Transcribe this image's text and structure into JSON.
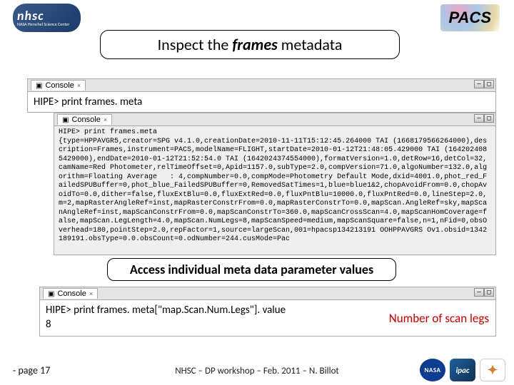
{
  "badges": {
    "nhsc_big": "nhsc",
    "nhsc_small": "NASA Herschel Science Center",
    "pacs": "PACS"
  },
  "title": {
    "pre": "Inspect the ",
    "em": "frames",
    "post": " metadata"
  },
  "console_tab": "Console",
  "cmd1": {
    "prompt": "HIPE>",
    "rest": " print frames. meta"
  },
  "output2": "HIPE> print frames.meta\n{type=HPPAVGR5,creator=SPG v4.1.0,creationDate=2010-11-11T15:12:45.264000 TAI (1668179566264000),description=Frames,instrument=PACS,modelName=FLIGHT,startDate=2010-01-12T21:48:05.429000 TAI (1642024085429000),endDate=2010-01-12T21:52:54.0 TAI (1642024374554000),formatVersion=1.0,detRow=16,detCol=32,camName=Red Photometer,relTimeOffset=0,Apid=1157.0,subType=2.0,compVersion=71.0,algoNumber=132.0,algorithm=Floating Average   : 4,compNumber=0.0,compMode=Photometry Default Mode,dxid=4001.0,phot_red_FailedSPUBuffer=0,phot_blue_FailedSPUBuffer=0,RemovedSatTimes=1,blue=blue1&2,chopAvoidFrom=0.0,chopAvoidTo=0.0,dither=false,fluxExtBlu=0.0,fluxExtRed=0.0,fluxPntBlu=10000.0,fluxPntRed=0.0,lineStep=2.0,m=2,mapRasterAngleRef=inst,mapRasterConstrFrom=0.0,mapRasterConstrTo=0.0,mapScan.AngleRef=sky,mapScanAngleRef=inst,mapScanConstrFrom=0.0,mapScanConstrTo=360.0,mapScanCrossScan=4.0,mapScanHomCoverage=false,mapScan.LegLength=4.0,mapScan.NumLegs=8,mapScanSpeed=medium,mapScanSquare=false,n=1,nFid=0,obsOverhead=180,pointStep=2.0,repFactor=1,source=largeScan,001=hpacsp134213191 OOHPPAVGRS Ov1.obsid=1342189191.obsType=0.0.obsCount=0.odNumber=244.cusMode=Pac",
  "subtitle": "Access individual meta data parameter values",
  "cmd3": {
    "prompt": "HIPE>",
    "rest": " print frames. meta[\"map.Scan.Num.Legs\"]. value",
    "result": "8"
  },
  "annotation": "Number of scan legs",
  "footer": {
    "page": "- page 17",
    "credit": "NHSC – DP workshop – Feb. 2011 – N. Billot"
  }
}
